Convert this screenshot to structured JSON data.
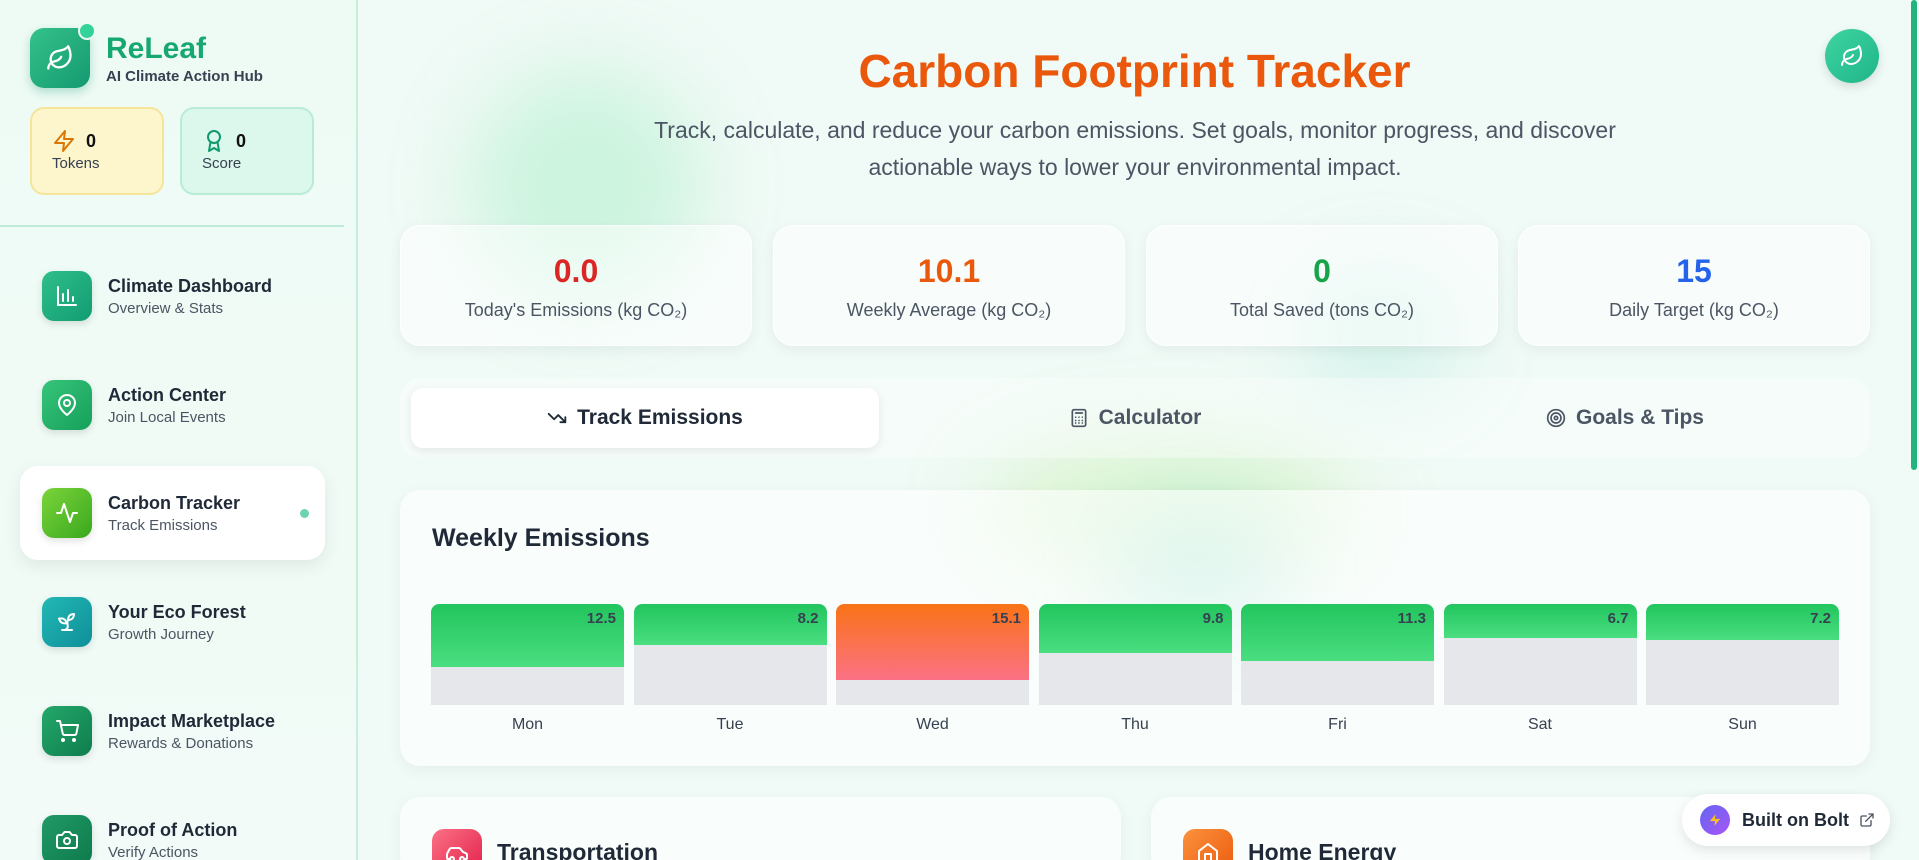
{
  "sidebar": {
    "brand": {
      "name": "ReLeaf",
      "tagline": "AI Climate Action Hub"
    },
    "stats": [
      {
        "value": "0",
        "label": "Tokens",
        "icon": "lightning-icon"
      },
      {
        "value": "0",
        "label": "Score",
        "icon": "award-icon"
      }
    ],
    "items": [
      {
        "title": "Climate Dashboard",
        "subtitle": "Overview & Stats",
        "icon": "bar-chart-icon"
      },
      {
        "title": "Action Center",
        "subtitle": "Join Local Events",
        "icon": "map-pin-icon"
      },
      {
        "title": "Carbon Tracker",
        "subtitle": "Track Emissions",
        "icon": "activity-icon",
        "active": true
      },
      {
        "title": "Your Eco Forest",
        "subtitle": "Growth Journey",
        "icon": "sprout-icon"
      },
      {
        "title": "Impact Marketplace",
        "subtitle": "Rewards & Donations",
        "icon": "cart-icon"
      },
      {
        "title": "Proof of Action",
        "subtitle": "Verify Actions",
        "icon": "camera-icon"
      }
    ]
  },
  "header": {
    "title": "Carbon Footprint Tracker",
    "description": "Track, calculate, and reduce your carbon emissions. Set goals, monitor progress, and discover actionable ways to lower your environmental impact."
  },
  "metrics": [
    {
      "value": "0.0",
      "label": "Today's Emissions (kg CO₂)",
      "color": "#dc2626"
    },
    {
      "value": "10.1",
      "label": "Weekly Average (kg CO₂)",
      "color": "#ea580c"
    },
    {
      "value": "0",
      "label": "Total Saved (tons CO₂)",
      "color": "#16a34a"
    },
    {
      "value": "15",
      "label": "Daily Target (kg CO₂)",
      "color": "#2563eb"
    }
  ],
  "tabs": [
    {
      "label": "Track Emissions",
      "icon": "trending-down-icon",
      "active": true
    },
    {
      "label": "Calculator",
      "icon": "calculator-icon"
    },
    {
      "label": "Goals & Tips",
      "icon": "target-icon"
    }
  ],
  "weekly": {
    "title": "Weekly Emissions",
    "chart_data": {
      "type": "bar",
      "categories": [
        "Mon",
        "Tue",
        "Wed",
        "Thu",
        "Fri",
        "Sat",
        "Sun"
      ],
      "values": [
        12.5,
        8.2,
        15.1,
        9.8,
        11.3,
        6.7,
        7.2
      ],
      "value_labels": [
        "12.5",
        "8.2",
        "15.1",
        "9.8",
        "11.3",
        "6.7",
        "7.2"
      ],
      "highlight": "Wed",
      "colors": {
        "normal": "#22c55e",
        "highlight": "#f97316",
        "track": "#e5e7eb"
      }
    }
  },
  "categories": [
    {
      "title": "Transportation",
      "icon": "car-icon",
      "color": "#f43f5e"
    },
    {
      "title": "Home Energy",
      "icon": "home-icon",
      "color": "#f97316"
    }
  ],
  "badge": {
    "label": "Built on Bolt"
  }
}
